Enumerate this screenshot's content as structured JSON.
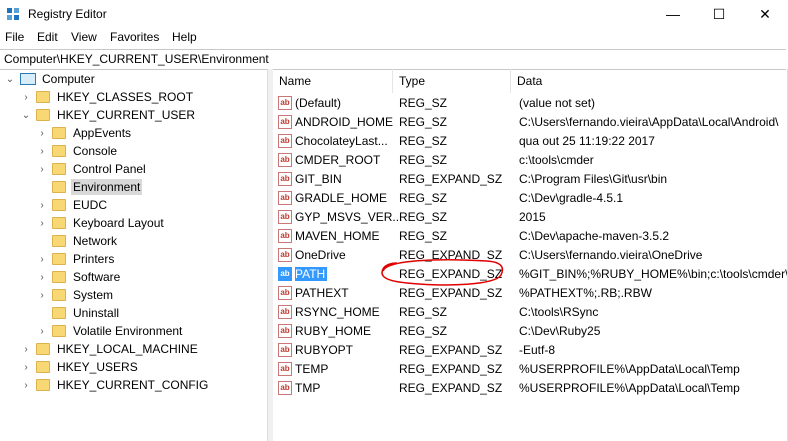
{
  "window": {
    "title": "Registry Editor",
    "minimize": "—",
    "maximize": "☐",
    "close": "✕"
  },
  "menu": [
    "File",
    "Edit",
    "View",
    "Favorites",
    "Help"
  ],
  "address": "Computer\\HKEY_CURRENT_USER\\Environment",
  "tree": [
    {
      "label": "Computer",
      "chev": "⌄",
      "icon": "computer"
    },
    {
      "label": "HKEY_CLASSES_ROOT",
      "chev": "›",
      "icon": "folder"
    },
    {
      "label": "HKEY_CURRENT_USER",
      "chev": "⌄",
      "icon": "folder"
    },
    {
      "label": "AppEvents",
      "chev": "›",
      "icon": "folder"
    },
    {
      "label": "Console",
      "chev": "›",
      "icon": "folder"
    },
    {
      "label": "Control Panel",
      "chev": "›",
      "icon": "folder"
    },
    {
      "label": "Environment",
      "chev": "",
      "icon": "folder",
      "selected": true
    },
    {
      "label": "EUDC",
      "chev": "›",
      "icon": "folder"
    },
    {
      "label": "Keyboard Layout",
      "chev": "›",
      "icon": "folder"
    },
    {
      "label": "Network",
      "chev": "",
      "icon": "folder"
    },
    {
      "label": "Printers",
      "chev": "›",
      "icon": "folder"
    },
    {
      "label": "Software",
      "chev": "›",
      "icon": "folder"
    },
    {
      "label": "System",
      "chev": "›",
      "icon": "folder"
    },
    {
      "label": "Uninstall",
      "chev": "",
      "icon": "folder"
    },
    {
      "label": "Volatile Environment",
      "chev": "›",
      "icon": "folder"
    },
    {
      "label": "HKEY_LOCAL_MACHINE",
      "chev": "›",
      "icon": "folder"
    },
    {
      "label": "HKEY_USERS",
      "chev": "›",
      "icon": "folder"
    },
    {
      "label": "HKEY_CURRENT_CONFIG",
      "chev": "›",
      "icon": "folder"
    }
  ],
  "columns": {
    "name": "Name",
    "type": "Type",
    "data": "Data"
  },
  "values": [
    {
      "name": "(Default)",
      "type": "REG_SZ",
      "data": "(value not set)"
    },
    {
      "name": "ANDROID_HOME",
      "type": "REG_SZ",
      "data": "C:\\Users\\fernando.vieira\\AppData\\Local\\Android\\"
    },
    {
      "name": "ChocolateyLast...",
      "type": "REG_SZ",
      "data": "qua out 25 11:19:22 2017"
    },
    {
      "name": "CMDER_ROOT",
      "type": "REG_SZ",
      "data": "c:\\tools\\cmder"
    },
    {
      "name": "GIT_BIN",
      "type": "REG_EXPAND_SZ",
      "data": "C:\\Program Files\\Git\\usr\\bin"
    },
    {
      "name": "GRADLE_HOME",
      "type": "REG_SZ",
      "data": "C:\\Dev\\gradle-4.5.1"
    },
    {
      "name": "GYP_MSVS_VER...",
      "type": "REG_SZ",
      "data": "2015"
    },
    {
      "name": "MAVEN_HOME",
      "type": "REG_SZ",
      "data": "C:\\Dev\\apache-maven-3.5.2"
    },
    {
      "name": "OneDrive",
      "type": "REG_EXPAND_SZ",
      "data": "C:\\Users\\fernando.vieira\\OneDrive"
    },
    {
      "name": "PATH",
      "type": "REG_EXPAND_SZ",
      "data": "%GIT_BIN%;%RUBY_HOME%\\bin;c:\\tools\\cmder\\...",
      "selected": true,
      "circled": true
    },
    {
      "name": "PATHEXT",
      "type": "REG_EXPAND_SZ",
      "data": "%PATHEXT%;.RB;.RBW"
    },
    {
      "name": "RSYNC_HOME",
      "type": "REG_SZ",
      "data": "C:\\tools\\RSync"
    },
    {
      "name": "RUBY_HOME",
      "type": "REG_SZ",
      "data": "C:\\Dev\\Ruby25"
    },
    {
      "name": "RUBYOPT",
      "type": "REG_EXPAND_SZ",
      "data": "-Eutf-8"
    },
    {
      "name": "TEMP",
      "type": "REG_EXPAND_SZ",
      "data": "%USERPROFILE%\\AppData\\Local\\Temp"
    },
    {
      "name": "TMP",
      "type": "REG_EXPAND_SZ",
      "data": "%USERPROFILE%\\AppData\\Local\\Temp"
    }
  ],
  "value_icon_text": "ab",
  "colors": {
    "selection": "#3399ff",
    "annotation": "#e00000",
    "folder": "#f8d775"
  }
}
